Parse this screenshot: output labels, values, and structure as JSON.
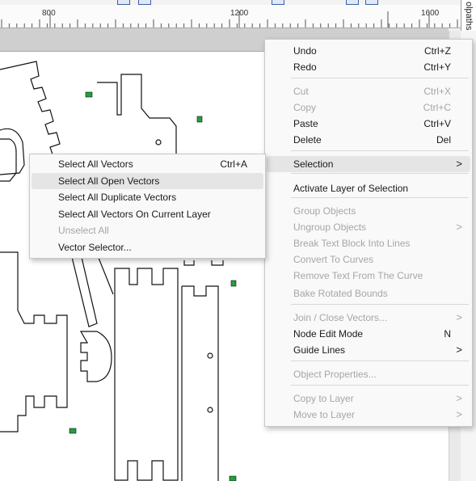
{
  "ruler": {
    "labels": [
      "800",
      "1200",
      "1600"
    ]
  },
  "side_tab": {
    "label": "olpaths"
  },
  "context_menu": {
    "items": [
      {
        "label": "Undo",
        "shortcut": "Ctrl+Z",
        "enabled": true
      },
      {
        "label": "Redo",
        "shortcut": "Ctrl+Y",
        "enabled": true
      },
      {
        "label": "Cut",
        "shortcut": "Ctrl+X",
        "enabled": false
      },
      {
        "label": "Copy",
        "shortcut": "Ctrl+C",
        "enabled": false
      },
      {
        "label": "Paste",
        "shortcut": "Ctrl+V",
        "enabled": true
      },
      {
        "label": "Delete",
        "shortcut": "Del",
        "enabled": true
      },
      {
        "label": "Selection",
        "shortcut": "",
        "enabled": true,
        "submenu": true
      },
      {
        "label": "Activate Layer of Selection",
        "shortcut": "",
        "enabled": true
      },
      {
        "label": "Group Objects",
        "shortcut": "",
        "enabled": false
      },
      {
        "label": "Ungroup Objects",
        "shortcut": "",
        "enabled": false,
        "submenu": true
      },
      {
        "label": "Break Text Block Into Lines",
        "shortcut": "",
        "enabled": false
      },
      {
        "label": "Convert To Curves",
        "shortcut": "",
        "enabled": false
      },
      {
        "label": "Remove Text From The Curve",
        "shortcut": "",
        "enabled": false
      },
      {
        "label": "Bake Rotated Bounds",
        "shortcut": "",
        "enabled": false
      },
      {
        "label": "Join / Close Vectors...",
        "shortcut": "",
        "enabled": false,
        "submenu": true
      },
      {
        "label": "Node Edit Mode",
        "shortcut": "N",
        "enabled": true
      },
      {
        "label": "Guide Lines",
        "shortcut": "",
        "enabled": true,
        "submenu": true
      },
      {
        "label": "Object Properties...",
        "shortcut": "",
        "enabled": false
      },
      {
        "label": "Copy to Layer",
        "shortcut": "",
        "enabled": false,
        "submenu": true
      },
      {
        "label": "Move to Layer",
        "shortcut": "",
        "enabled": false,
        "submenu": true
      }
    ],
    "arrow_glyph": ">"
  },
  "selection_submenu": {
    "items": [
      {
        "label": "Select All Vectors",
        "shortcut": "Ctrl+A",
        "enabled": true
      },
      {
        "label": "Select All Open Vectors",
        "shortcut": "",
        "enabled": true
      },
      {
        "label": "Select All Duplicate Vectors",
        "shortcut": "",
        "enabled": true
      },
      {
        "label": "Select All Vectors On Current Layer",
        "shortcut": "",
        "enabled": true
      },
      {
        "label": "Unselect All",
        "shortcut": "",
        "enabled": false
      },
      {
        "label": "Vector Selector...",
        "shortcut": "",
        "enabled": true
      }
    ]
  },
  "colors": {
    "menu_bg": "#f9f9f9",
    "disabled_text": "#a6a6a6",
    "highlight": "#e5e5e5",
    "marker_green": "#22a13a"
  }
}
